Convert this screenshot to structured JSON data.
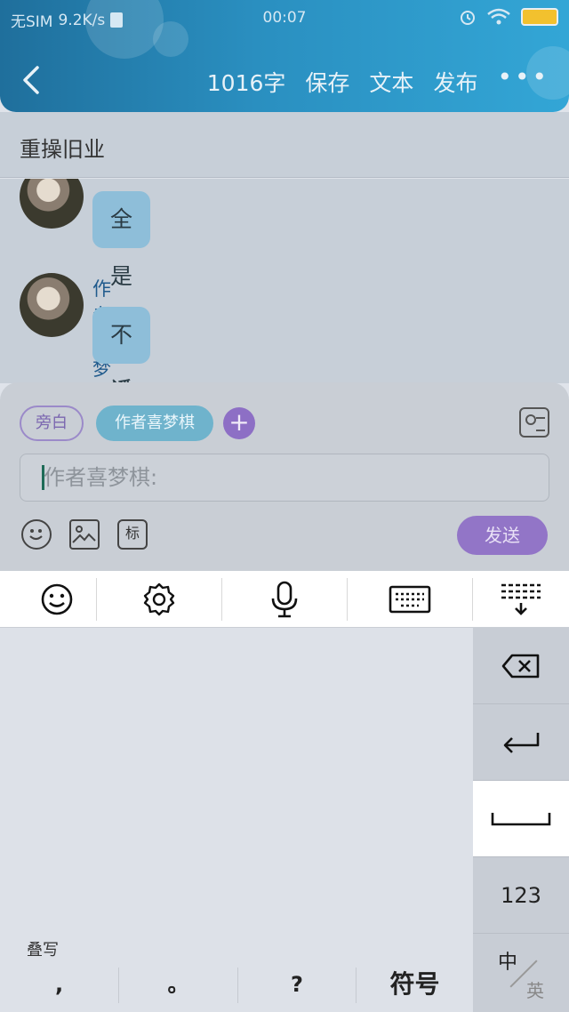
{
  "status_bar": {
    "carrier": "无SIM",
    "net_speed": "9.2K/s",
    "time": "00:07",
    "battery_color": "#f2c12e"
  },
  "header": {
    "word_count": "1016字",
    "save_label": "保存",
    "text_label": "文本",
    "publish_label": "发布",
    "more_label": "•••"
  },
  "subtitle": "重操旧业",
  "messages": [
    {
      "author": "",
      "text": "全是废话"
    },
    {
      "author": "作者喜梦棋",
      "text": "不说了"
    }
  ],
  "input_panel": {
    "role_narration": "旁白",
    "role_author": "作者喜梦棋",
    "add_role": "+",
    "placeholder": "作者喜梦棋:",
    "mark_label": "标",
    "send_label": "发送",
    "accent_color": "#9275c7"
  },
  "keyboard_toolbar": {
    "items": [
      "emoji-icon",
      "settings-icon",
      "microphone-icon",
      "keyboard-icon",
      "collapse-keyboard-icon"
    ]
  },
  "keyboard": {
    "handwriting_hint": "叠写",
    "punctuation": [
      ",",
      "。",
      "?",
      "符号"
    ],
    "side_keys": {
      "backspace": "backspace-icon",
      "enter": "enter-icon",
      "space": "space-icon",
      "numbers": "123",
      "lang_zh": "中",
      "lang_en": "英"
    }
  }
}
